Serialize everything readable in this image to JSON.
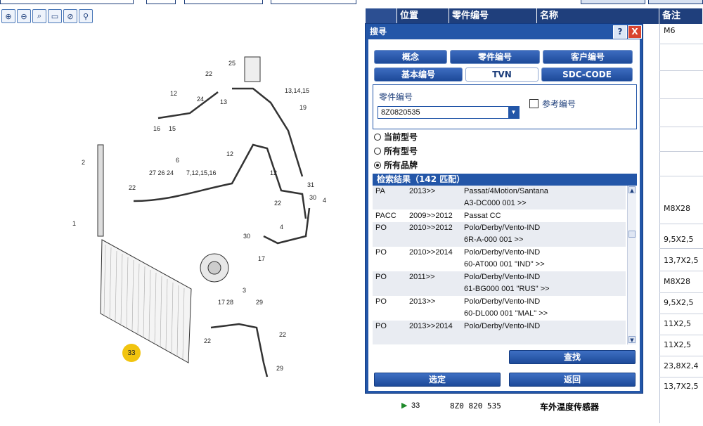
{
  "diagram": {
    "callouts": [
      "25",
      "22",
      "13,14,15",
      "24",
      "12",
      "13",
      "19",
      "16",
      "15",
      "12",
      "6",
      "12",
      "2",
      "27 26 24",
      "7,12,15,16",
      "31",
      "30",
      "4",
      "22",
      "1",
      "22",
      "30",
      "17",
      "4",
      "3",
      "17",
      "28",
      "29",
      "22",
      "22",
      "29",
      "33"
    ],
    "highlighted_part": "33"
  },
  "parts_table": {
    "headers": [
      "位置",
      "零件编号",
      "名称",
      "备注"
    ],
    "notes": [
      "M6",
      "M8X28",
      "9,5X2,5",
      "13,7X2,5",
      "M8X28",
      "9,5X2,5",
      "11X2,5",
      "11X2,5",
      "23,8X2,4",
      "13,7X2,5"
    ],
    "last_row": {
      "pos": "33",
      "part_no": "8Z0 820 535",
      "name": "车外温度传感器"
    }
  },
  "dialog": {
    "title": "搜寻",
    "help": "?",
    "close": "X",
    "tabs": [
      "概念",
      "零件编号",
      "客户编号",
      "基本编号",
      "TVN",
      "SDC-CODE"
    ],
    "field_label": "零件编号",
    "field_value": "8Z0820535",
    "checkbox_label": "参考编号",
    "radios": [
      "当前型号",
      "所有型号",
      "所有品牌"
    ],
    "selected_radio": 2,
    "results_header": "检索结果（142 匹配）",
    "results": [
      {
        "code": "PA",
        "year": "2013>>",
        "model": "Passat/4Motion/Santana",
        "range": "A3-DC000 001 >>"
      },
      {
        "code": "PACC",
        "year": "2009>>2012",
        "model": "Passat CC",
        "range": ""
      },
      {
        "code": "PO",
        "year": "2010>>2012",
        "model": "Polo/Derby/Vento-IND",
        "range": "6R-A-000 001 >>"
      },
      {
        "code": "PO",
        "year": "2010>>2014",
        "model": "Polo/Derby/Vento-IND",
        "range": "60-AT000 001 \"IND\" >>"
      },
      {
        "code": "PO",
        "year": "2011>>",
        "model": "Polo/Derby/Vento-IND",
        "range": "61-BG000 001 \"RUS\" >>"
      },
      {
        "code": "PO",
        "year": "2013>>",
        "model": "Polo/Derby/Vento-IND",
        "range": "60-DL000 001 \"MAL\" >>"
      },
      {
        "code": "PO",
        "year": "2013>>2014",
        "model": "Polo/Derby/Vento-IND",
        "range": ""
      }
    ],
    "find_btn": "查找",
    "select_btn": "选定",
    "back_btn": "返回"
  },
  "colors": {
    "accent": "#2356a8",
    "header": "#1f3f7c",
    "badge": "#f1c40f"
  }
}
